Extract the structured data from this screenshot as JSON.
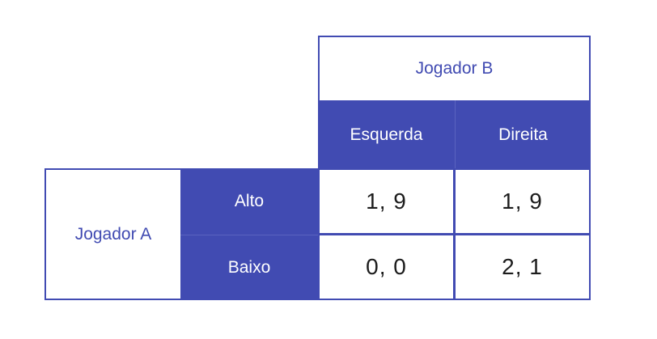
{
  "game": {
    "player_b": "Jogador B",
    "player_a": "Jogador A",
    "b_strategies": [
      "Esquerda",
      "Direita"
    ],
    "a_strategies": [
      "Alto",
      "Baixo"
    ],
    "payoffs": [
      [
        "1, 9",
        "1, 9"
      ],
      [
        "0, 0",
        "2, 1"
      ]
    ]
  },
  "colors": {
    "accent": "#414bb2",
    "text": "#1c1c1c",
    "background": "#ffffff"
  }
}
